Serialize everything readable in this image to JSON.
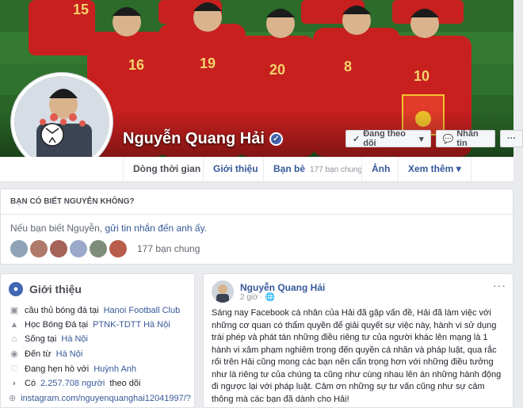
{
  "profile": {
    "name": "Nguyễn Quang Hải",
    "jersey_numbers": [
      "15",
      "16",
      "19",
      "20",
      "8",
      "10"
    ],
    "follow_label": "Đang theo dõi",
    "message_label": "Nhắn tin",
    "more_label": "···"
  },
  "tabs": [
    {
      "label": "Dòng thời gian"
    },
    {
      "label": "Giới thiệu"
    },
    {
      "label": "Bạn bè",
      "count": "177 bạn chung"
    },
    {
      "label": "Ảnh"
    },
    {
      "label": "Xem thêm"
    }
  ],
  "know": {
    "title": "BẠN CÓ BIẾT NGUYỄN KHÔNG?",
    "text_prefix": "Nếu bạn biết Nguyễn,",
    "link": "gửi tin nhắn đến anh ấy.",
    "mutual_count": "177 bạn chung"
  },
  "intro": {
    "title": "Giới thiệu",
    "rows": [
      {
        "icon": "briefcase-icon",
        "text": "cầu thủ bóng đá tại",
        "link": "Hanoi Football Club"
      },
      {
        "icon": "graduation-cap-icon",
        "text": "Học Bóng Đá tại",
        "link": "PTNK-TDTT Hà Nội"
      },
      {
        "icon": "home-icon",
        "text": "Sống tại",
        "link": "Hà Nội"
      },
      {
        "icon": "map-pin-icon",
        "text": "Đến từ",
        "link": "Hà Nội"
      },
      {
        "icon": "heart-icon",
        "text": "Đang hẹn hò với",
        "link": "Huỳnh Anh"
      },
      {
        "icon": "rss-icon",
        "text": "Có",
        "link": "2.257.708 người",
        "suffix": "theo dõi"
      },
      {
        "icon": "globe-icon",
        "text": "",
        "link": "instagram.com/nguyenquanghai12041997/?"
      }
    ]
  },
  "post": {
    "author": "Nguyễn Quang Hải",
    "time": "2 giờ ·",
    "body": "Sáng nay Facebook cá nhân của Hải đã gặp vấn đề, Hải đã làm việc với những cơ quan có thẩm quyền để giải quyết sự việc này, hành vi sử dụng trái phép và phát tán những điều riêng tư của người khác lên mạng là 1 hành vi xâm phạm nghiêm trọng đến quyền cá nhân và pháp luật, qua rắc rối trên Hải cũng mong các bạn nên cẩn trọng hơn với những điều tưởng như là riêng tư của chúng ta cũng như cùng nhau lên án những hành động đi ngược lại với pháp luật. Cảm ơn những sự tư vấn cũng như sự cảm thông mà các bạn đã dành cho Hải!",
    "more": "···"
  }
}
